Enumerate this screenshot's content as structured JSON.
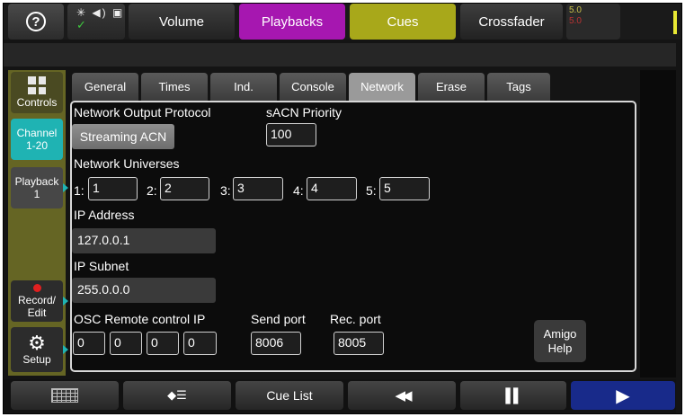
{
  "topbar": {
    "help_symbol": "?",
    "status_icons": "✳ ◀) ▣",
    "status_check": "✓",
    "volume_label": "Volume",
    "playbacks_label": "Playbacks",
    "cues_label": "Cues",
    "crossfader_label": "Crossfader",
    "version_top": "5.0",
    "version_bottom": "5.0"
  },
  "sidebar": {
    "controls_label": "Controls",
    "channel_label_1": "Channel",
    "channel_label_2": "1-20",
    "playback_label_1": "Playback",
    "playback_label_2": "1",
    "record_label_1": "Record/",
    "record_label_2": "Edit",
    "setup_label": "Setup"
  },
  "tabs": [
    {
      "label": "General",
      "active": false
    },
    {
      "label": "Times",
      "active": false
    },
    {
      "label": "Ind.",
      "active": false
    },
    {
      "label": "Console",
      "active": false
    },
    {
      "label": "Network",
      "active": true
    },
    {
      "label": "Erase",
      "active": false
    },
    {
      "label": "Tags",
      "active": false
    }
  ],
  "network": {
    "protocol_label": "Network Output Protocol",
    "protocol_value": "Streaming ACN",
    "sacn_priority_label": "sACN Priority",
    "sacn_priority_value": "100",
    "universes_label": "Network Universes",
    "universes": [
      {
        "label": "1:",
        "value": "1"
      },
      {
        "label": "2:",
        "value": "2"
      },
      {
        "label": "3:",
        "value": "3"
      },
      {
        "label": "4:",
        "value": "4"
      },
      {
        "label": "5:",
        "value": "5"
      }
    ],
    "ip_address_label": "IP Address",
    "ip_address_value": "127.0.0.1",
    "ip_subnet_label": "IP Subnet",
    "ip_subnet_value": "255.0.0.0",
    "osc_label": "OSC Remote control IP",
    "osc_octets": [
      "0",
      "0",
      "0",
      "0"
    ],
    "send_port_label": "Send port",
    "send_port_value": "8006",
    "rec_port_label": "Rec. port",
    "rec_port_value": "8005",
    "amigo_label_1": "Amigo",
    "amigo_label_2": "Help"
  },
  "bottombar": {
    "cue_list_label": "Cue List",
    "palette_icon": "◆☰",
    "rewind_icon": "◀◀",
    "pause_icon": "▌▌",
    "play_icon": "▶"
  }
}
